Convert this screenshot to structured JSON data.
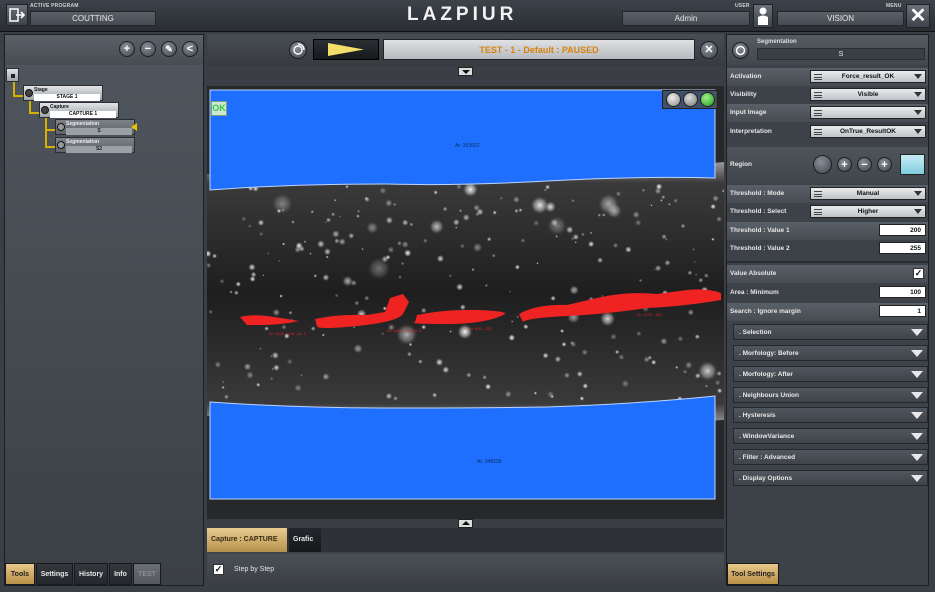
{
  "top": {
    "active_program_caption": "ACTIVE PROGRAM",
    "active_program": "COUTTING",
    "logo": "LAZPIUR",
    "user_caption": "USER",
    "user": "Admin",
    "menu_caption": "MENU",
    "menu_value": "VISION",
    "close_glyph": "✕"
  },
  "tree": {
    "stage": {
      "caption": "Stage",
      "value": "STAGE 1"
    },
    "capture": {
      "caption": "Capture",
      "value": "CAPTURE 1"
    },
    "segmentation_1": {
      "caption": "Segmentation",
      "value": "S"
    },
    "segmentation_2": {
      "caption": "Segmentation",
      "value": "S2"
    }
  },
  "left_tools": {
    "add": "+",
    "remove": "−",
    "edit": "✎",
    "share": "<"
  },
  "bottom_tabs": [
    "Tools",
    "Settings",
    "History",
    "Info",
    "TEST"
  ],
  "center": {
    "status": "TEST - 1 - Default  :  PAUSED",
    "ok_label": "OK",
    "area_top_label": "Ar: 353622",
    "area_bottom_label": "Ar: 348239",
    "defect_labels": [
      "Ar: 1020 - 318 - Ar: 2",
      "Ar: 1180 - 304 Ar: 4",
      "Ar: 820 - 312",
      "Ar: 1270 - 322"
    ],
    "tabs": [
      "Capture : CAPTURE 1",
      "Grafic"
    ],
    "step_by_step": "Step by Step",
    "step_checked": "✓"
  },
  "right": {
    "header_caption": "Segmentation",
    "header_value": "S",
    "props": [
      {
        "label": "Activation",
        "value": "Force_result_OK"
      },
      {
        "label": "Visibility",
        "value": "Visible"
      },
      {
        "label": "Input Image",
        "value": ""
      },
      {
        "label": "Interpretation",
        "value": "OnTrue_ResultOK"
      }
    ],
    "region_label": "Region",
    "threshold": [
      {
        "label": "Threshold : Mode",
        "value": "Manual"
      },
      {
        "label": "Threshold : Select",
        "value": "Higher"
      }
    ],
    "values": [
      {
        "label": "Threshold : Value 1",
        "value": "200"
      },
      {
        "label": "Threshold : Value 2",
        "value": "255"
      }
    ],
    "value_absolute_label": "Value Absolute",
    "value_absolute_checked": "✓",
    "area_values": [
      {
        "label": "Area : Minimum",
        "value": "100"
      },
      {
        "label": "Search : Ignore margin",
        "value": "1"
      }
    ],
    "sections": [
      ". Selection",
      ". Morfology: Before",
      ". Morfology: After",
      ". Neighbours Union",
      ". Hysteresis",
      ". WindowVariance",
      ". Filter : Advanced",
      ". Display Options"
    ],
    "tool_settings_tab": "Tool Settings"
  },
  "colors": {
    "blue_region": "#1f6fff",
    "defect_red": "#f02323",
    "status_orange": "#d7820d",
    "ok_green": "#39c447",
    "tab_active": "#e0bd7f",
    "tree_line": "#d7b100"
  }
}
